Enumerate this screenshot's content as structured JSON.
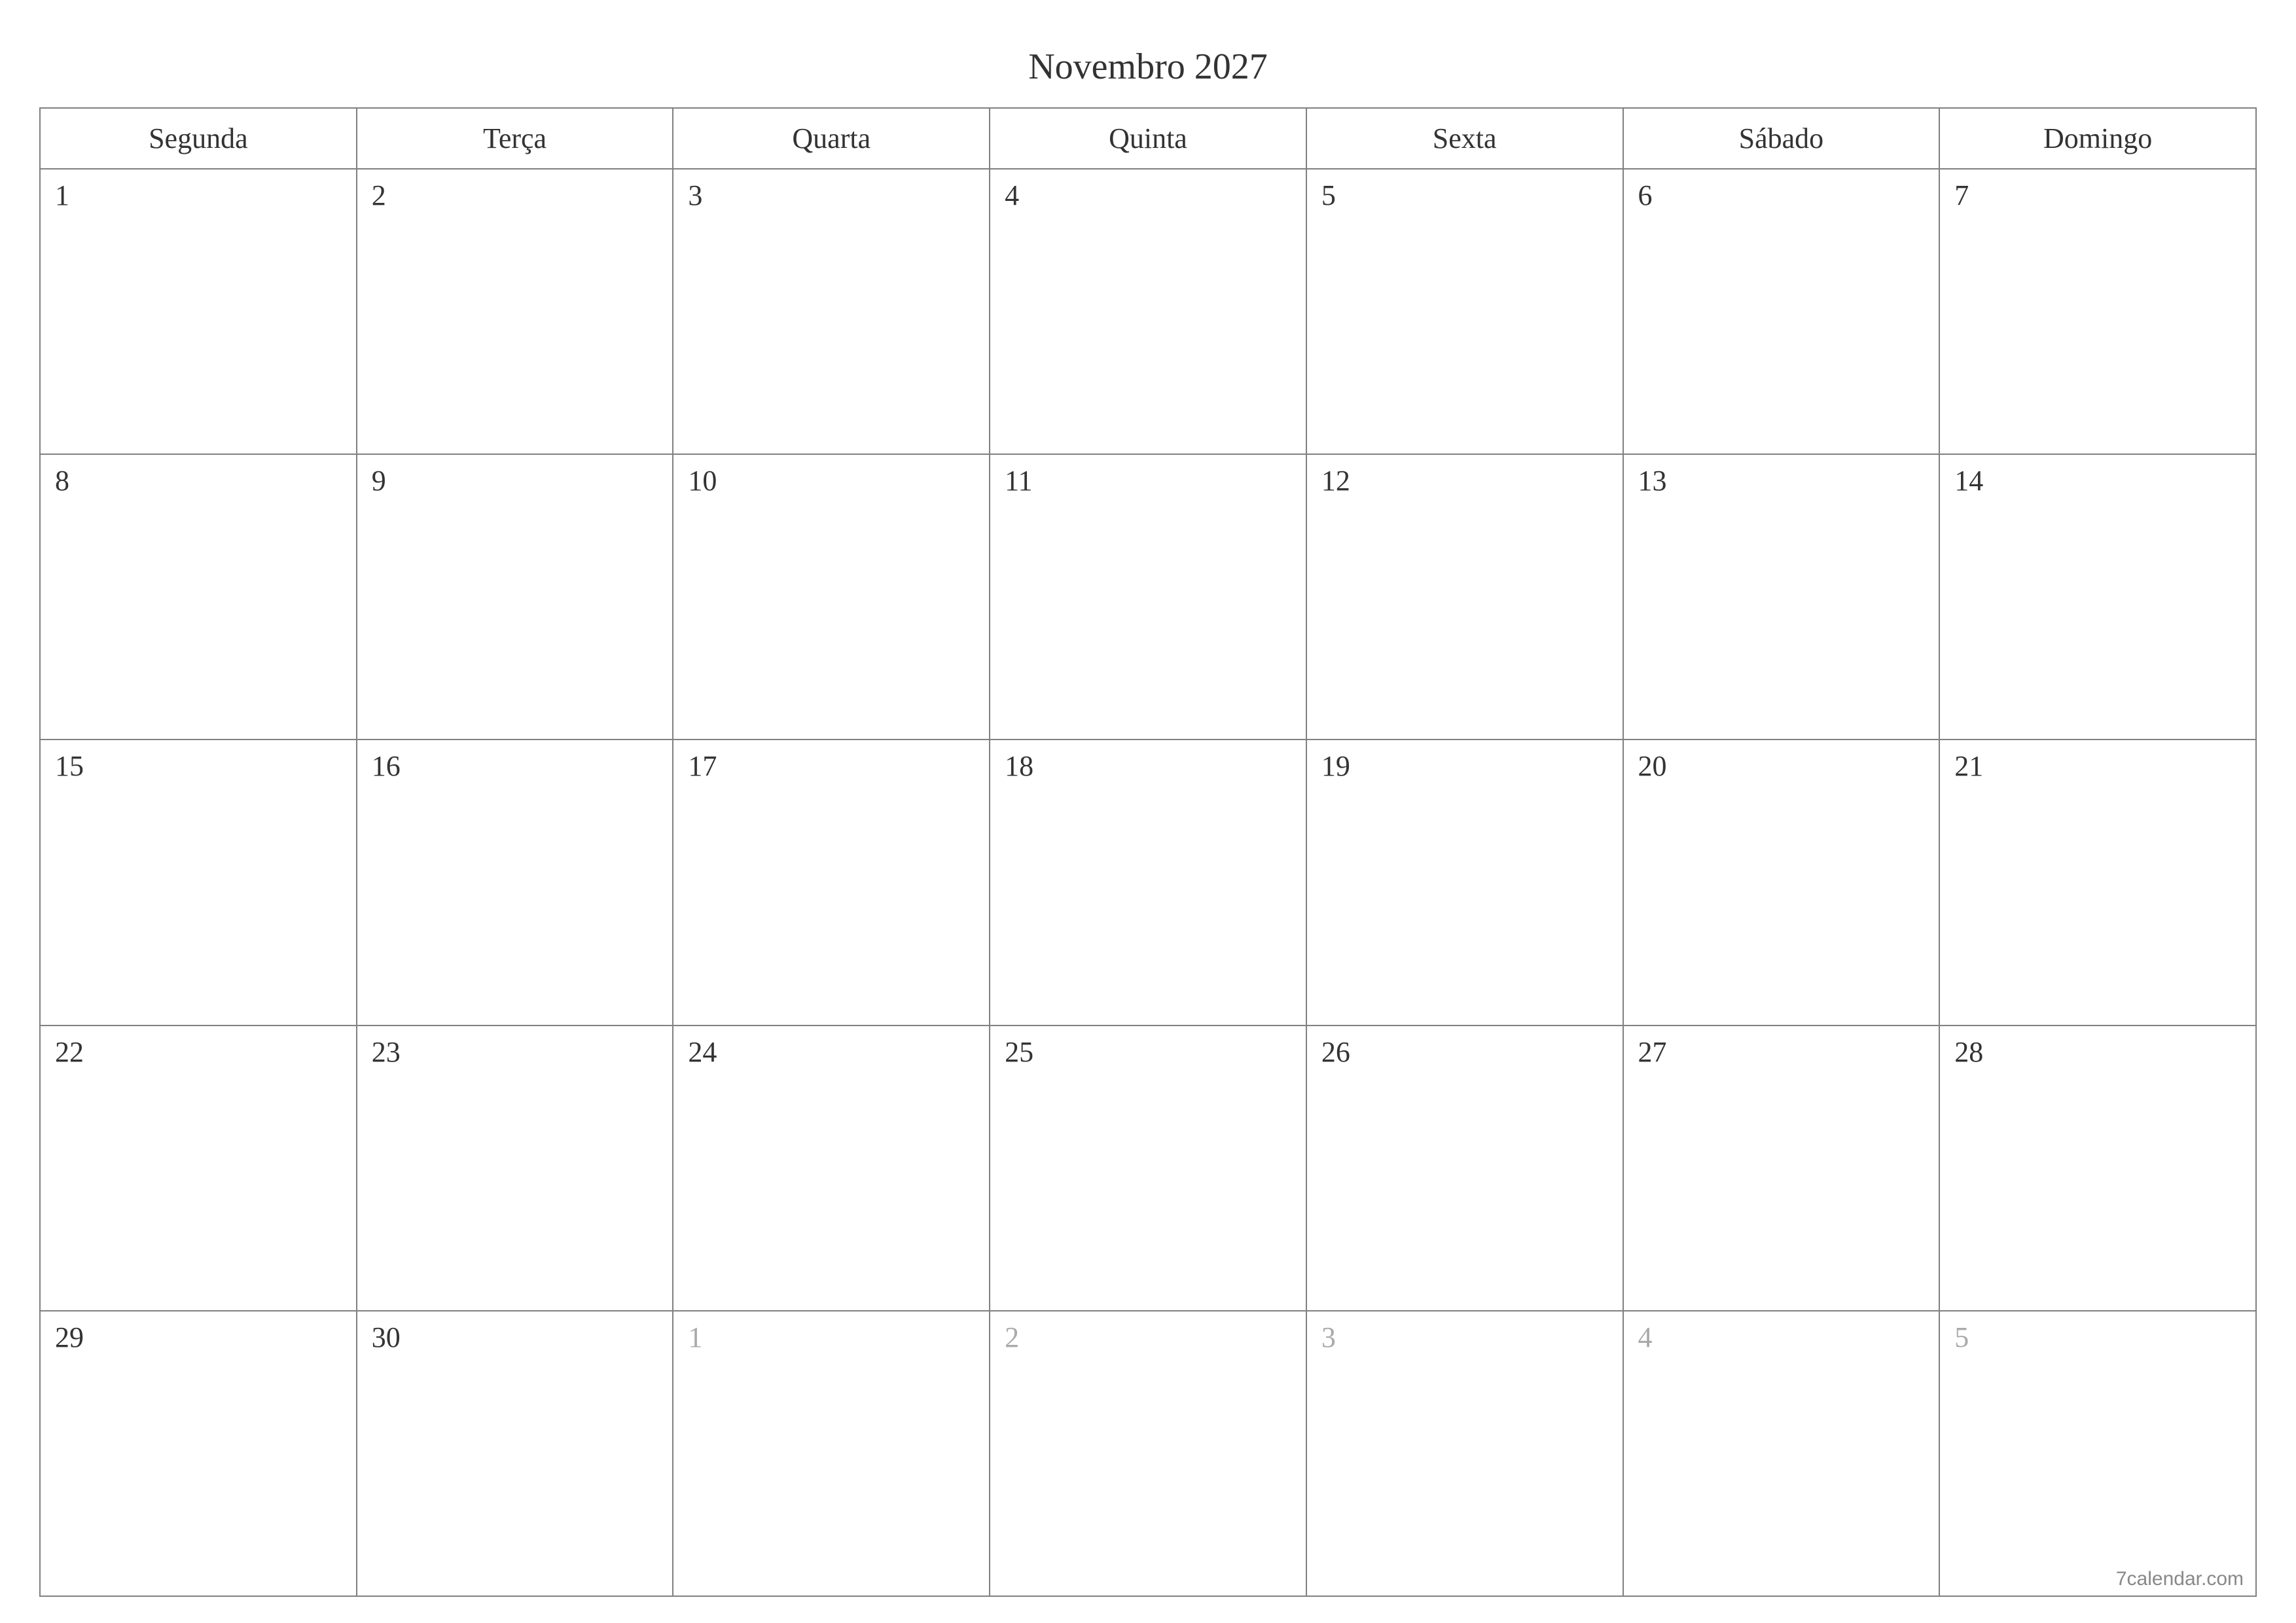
{
  "title": "Novembro 2027",
  "weekdays": [
    "Segunda",
    "Terça",
    "Quarta",
    "Quinta",
    "Sexta",
    "Sábado",
    "Domingo"
  ],
  "weeks": [
    [
      {
        "day": "1",
        "otherMonth": false
      },
      {
        "day": "2",
        "otherMonth": false
      },
      {
        "day": "3",
        "otherMonth": false
      },
      {
        "day": "4",
        "otherMonth": false
      },
      {
        "day": "5",
        "otherMonth": false
      },
      {
        "day": "6",
        "otherMonth": false
      },
      {
        "day": "7",
        "otherMonth": false
      }
    ],
    [
      {
        "day": "8",
        "otherMonth": false
      },
      {
        "day": "9",
        "otherMonth": false
      },
      {
        "day": "10",
        "otherMonth": false
      },
      {
        "day": "11",
        "otherMonth": false
      },
      {
        "day": "12",
        "otherMonth": false
      },
      {
        "day": "13",
        "otherMonth": false
      },
      {
        "day": "14",
        "otherMonth": false
      }
    ],
    [
      {
        "day": "15",
        "otherMonth": false
      },
      {
        "day": "16",
        "otherMonth": false
      },
      {
        "day": "17",
        "otherMonth": false
      },
      {
        "day": "18",
        "otherMonth": false
      },
      {
        "day": "19",
        "otherMonth": false
      },
      {
        "day": "20",
        "otherMonth": false
      },
      {
        "day": "21",
        "otherMonth": false
      }
    ],
    [
      {
        "day": "22",
        "otherMonth": false
      },
      {
        "day": "23",
        "otherMonth": false
      },
      {
        "day": "24",
        "otherMonth": false
      },
      {
        "day": "25",
        "otherMonth": false
      },
      {
        "day": "26",
        "otherMonth": false
      },
      {
        "day": "27",
        "otherMonth": false
      },
      {
        "day": "28",
        "otherMonth": false
      }
    ],
    [
      {
        "day": "29",
        "otherMonth": false
      },
      {
        "day": "30",
        "otherMonth": false
      },
      {
        "day": "1",
        "otherMonth": true
      },
      {
        "day": "2",
        "otherMonth": true
      },
      {
        "day": "3",
        "otherMonth": true
      },
      {
        "day": "4",
        "otherMonth": true
      },
      {
        "day": "5",
        "otherMonth": true
      }
    ]
  ],
  "footer": "7calendar.com"
}
